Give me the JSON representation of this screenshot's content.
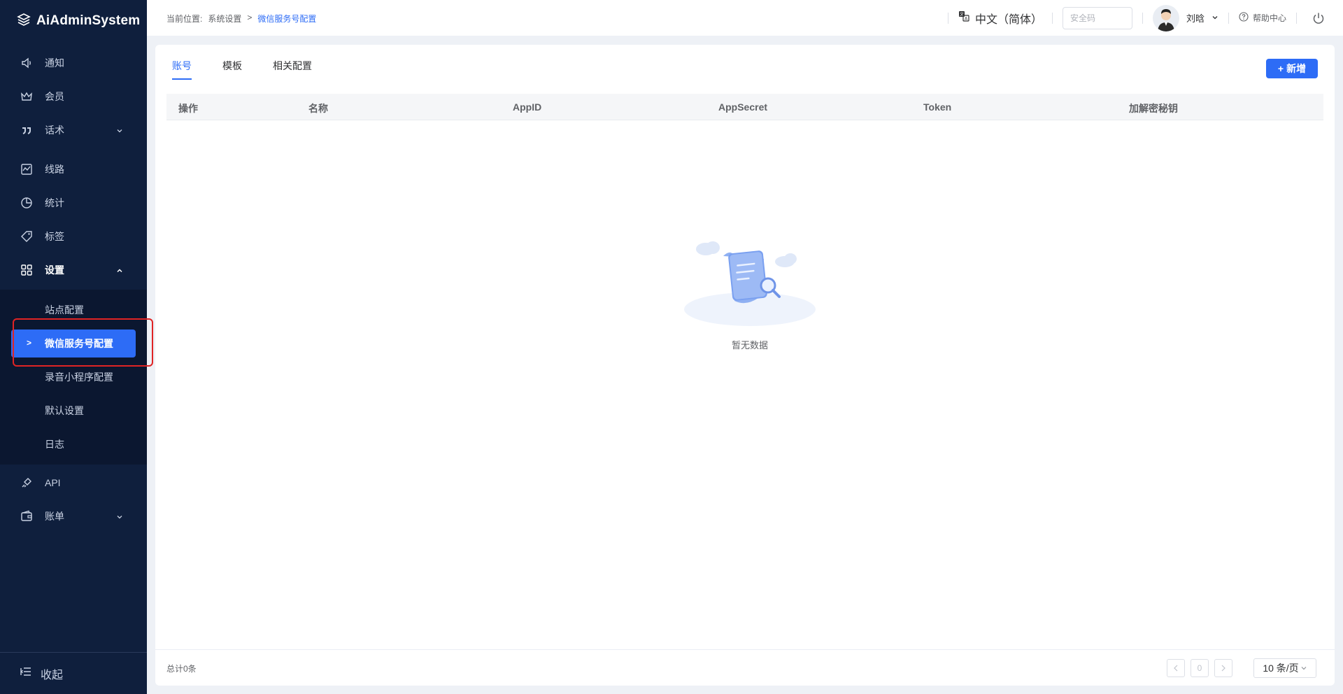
{
  "app": {
    "title": "AiAdminSystem"
  },
  "sidebar": {
    "items": [
      {
        "label": "通知",
        "icon": "speaker-icon"
      },
      {
        "label": "会员",
        "icon": "crown-icon"
      },
      {
        "label": "话术",
        "icon": "quote-icon"
      },
      {
        "label": "线路",
        "icon": "line-chart-icon"
      },
      {
        "label": "统计",
        "icon": "pie-icon"
      },
      {
        "label": "标签",
        "icon": "tag-icon"
      },
      {
        "label": "设置",
        "icon": "grid-icon"
      },
      {
        "label": "API",
        "icon": "plug-icon"
      },
      {
        "label": "账单",
        "icon": "wallet-icon"
      }
    ],
    "settings_sub": [
      {
        "label": "站点配置"
      },
      {
        "label": "微信服务号配置"
      },
      {
        "label": "录音小程序配置"
      },
      {
        "label": "默认设置"
      },
      {
        "label": "日志"
      }
    ],
    "collapse_label": "收起"
  },
  "header": {
    "breadcrumb": {
      "prefix": "当前位置:",
      "parent": "系统设置",
      "sep": ">",
      "current": "微信服务号配置"
    },
    "language": "中文（简体）",
    "security_placeholder": "安全码",
    "user_name": "刘晗",
    "help": "帮助中心"
  },
  "main": {
    "tabs": [
      {
        "label": "账号"
      },
      {
        "label": "模板"
      },
      {
        "label": "相关配置"
      }
    ],
    "add_button": "新增",
    "columns": [
      "操作",
      "名称",
      "AppID",
      "AppSecret",
      "Token",
      "加解密秘钥"
    ],
    "empty_text": "暂无数据",
    "footer": {
      "total": "总计0条",
      "page": "0",
      "page_size": "10 条/页"
    }
  },
  "colors": {
    "accent": "#2d6cf6",
    "sidebar_bg": "#0f1f3d",
    "highlight": "#e02424"
  }
}
